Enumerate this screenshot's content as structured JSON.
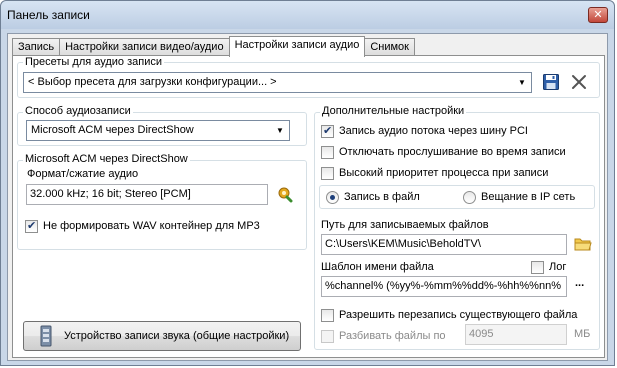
{
  "window": {
    "title": "Панель записи",
    "close_glyph": "✕"
  },
  "tabs": [
    {
      "label": "Запись"
    },
    {
      "label": "Настройки записи видео/аудио"
    },
    {
      "label": "Настройки записи аудио"
    },
    {
      "label": "Снимок"
    }
  ],
  "presets": {
    "label": "Пресеты для аудио записи",
    "value": "< Выбор пресета для загрузки конфигурации... >"
  },
  "method": {
    "label": "Способ аудиозаписи",
    "value": "Microsoft ACM через DirectShow"
  },
  "acm": {
    "label": "Microsoft ACM через DirectShow",
    "format_label": "Формат/сжатие аудио",
    "format_value": "32.000 kHz; 16 bit; Stereo [PCM]",
    "no_wav_label": "Не формировать WAV контейнер для MP3"
  },
  "device_button": {
    "label": "Устройство записи звука (общие настройки)"
  },
  "extra": {
    "label": "Дополнительные настройки",
    "pci_label": "Запись аудио потока через шину PCI",
    "monitor_label": "Отключать прослушивание во время записи",
    "priority_label": "Высокий приоритет процесса при записи"
  },
  "mode": {
    "file_label": "Запись в файл",
    "ip_label": "Вещание в IP сеть"
  },
  "path": {
    "label": "Путь для записываемых файлов",
    "value": "C:\\Users\\KEM\\Music\\BeholdTV\\"
  },
  "template": {
    "label": "Шаблон имени файла",
    "log_label": "Лог",
    "value": "%channel% (%yy%-%mm%%dd%-%hh%%nn%",
    "dots": "..."
  },
  "overwrite": {
    "label": "Разрешить перезапись существующего файла"
  },
  "split": {
    "label": "Разбивать файлы по",
    "value": "4095",
    "unit": "МБ"
  },
  "colors": {
    "accent": "#1e3a6e",
    "title_bar": "#bccde3",
    "panel": "#ffffff"
  }
}
